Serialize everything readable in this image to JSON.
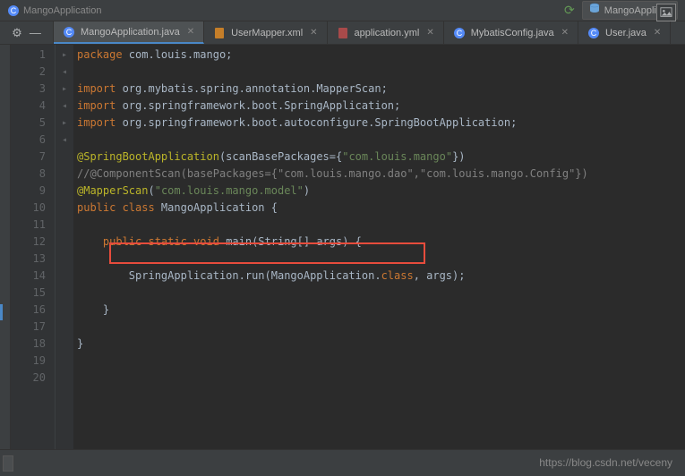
{
  "breadcrumb": {
    "item": "MangoApplication"
  },
  "topRight": {
    "badge": "MangoApplicati"
  },
  "tabs": [
    {
      "label": "MangoApplication.java",
      "active": true,
      "icon": "class"
    },
    {
      "label": "UserMapper.xml",
      "active": false,
      "icon": "xml"
    },
    {
      "label": "application.yml",
      "active": false,
      "icon": "yml"
    },
    {
      "label": "MybatisConfig.java",
      "active": false,
      "icon": "class"
    },
    {
      "label": "User.java",
      "active": false,
      "icon": "class"
    }
  ],
  "code": {
    "lines": [
      {
        "n": 1,
        "segments": [
          {
            "c": "kw",
            "t": "package "
          },
          {
            "c": "pkg",
            "t": "com.louis.mango"
          },
          {
            "c": "pkg",
            "t": ";"
          }
        ]
      },
      {
        "n": 2,
        "segments": []
      },
      {
        "n": 3,
        "mark": "▸",
        "segments": [
          {
            "c": "kw",
            "t": "import "
          },
          {
            "c": "pkg",
            "t": "org.mybatis.spring.annotation.MapperScan"
          },
          {
            "c": "pkg",
            "t": ";"
          }
        ]
      },
      {
        "n": 4,
        "segments": [
          {
            "c": "kw",
            "t": "import "
          },
          {
            "c": "pkg",
            "t": "org.springframework.boot.SpringApplication"
          },
          {
            "c": "pkg",
            "t": ";"
          }
        ]
      },
      {
        "n": 5,
        "mark": "◂",
        "segments": [
          {
            "c": "kw",
            "t": "import "
          },
          {
            "c": "pkg",
            "t": "org.springframework.boot.autoconfigure.SpringBootApplication"
          },
          {
            "c": "pkg",
            "t": ";"
          }
        ]
      },
      {
        "n": 6,
        "segments": []
      },
      {
        "n": 7,
        "mark": "▸",
        "segments": [
          {
            "c": "ann",
            "t": "@SpringBootApplication"
          },
          {
            "c": "pkg",
            "t": "(scanBasePackages={"
          },
          {
            "c": "str",
            "t": "\"com.louis.mango\""
          },
          {
            "c": "pkg",
            "t": "})"
          }
        ]
      },
      {
        "n": 8,
        "segments": [
          {
            "c": "cmt",
            "t": "//@ComponentScan(basePackages={\"com.louis.mango.dao\",\"com.louis.mango.Config\"})"
          }
        ]
      },
      {
        "n": 9,
        "mark": "◂",
        "segments": [
          {
            "c": "ann",
            "t": "@MapperScan"
          },
          {
            "c": "pkg",
            "t": "("
          },
          {
            "c": "str",
            "t": "\"com.louis.mango.model\""
          },
          {
            "c": "pkg",
            "t": ")"
          }
        ]
      },
      {
        "n": 10,
        "segments": [
          {
            "c": "kw",
            "t": "public class "
          },
          {
            "c": "cls",
            "t": "MangoApplication {"
          }
        ]
      },
      {
        "n": 11,
        "segments": []
      },
      {
        "n": 12,
        "mark": "▸",
        "indent": 1,
        "segments": [
          {
            "c": "kw",
            "t": "public static void "
          },
          {
            "c": "cls",
            "t": "main(String[] args) {"
          }
        ]
      },
      {
        "n": 13,
        "segments": []
      },
      {
        "n": 14,
        "indent": 2,
        "segments": [
          {
            "c": "cls",
            "t": "SpringApplication.run(MangoApplication."
          },
          {
            "c": "kw",
            "t": "class"
          },
          {
            "c": "cls",
            "t": ", args);"
          }
        ]
      },
      {
        "n": 15,
        "segments": []
      },
      {
        "n": 16,
        "mark": "◂",
        "indent": 1,
        "segments": [
          {
            "c": "cls",
            "t": "}"
          }
        ]
      },
      {
        "n": 17,
        "segments": []
      },
      {
        "n": 18,
        "segments": [
          {
            "c": "cls",
            "t": "}"
          }
        ]
      },
      {
        "n": 19,
        "segments": []
      },
      {
        "n": 20,
        "segments": []
      }
    ]
  },
  "watermark": "https://blog.csdn.net/veceny"
}
